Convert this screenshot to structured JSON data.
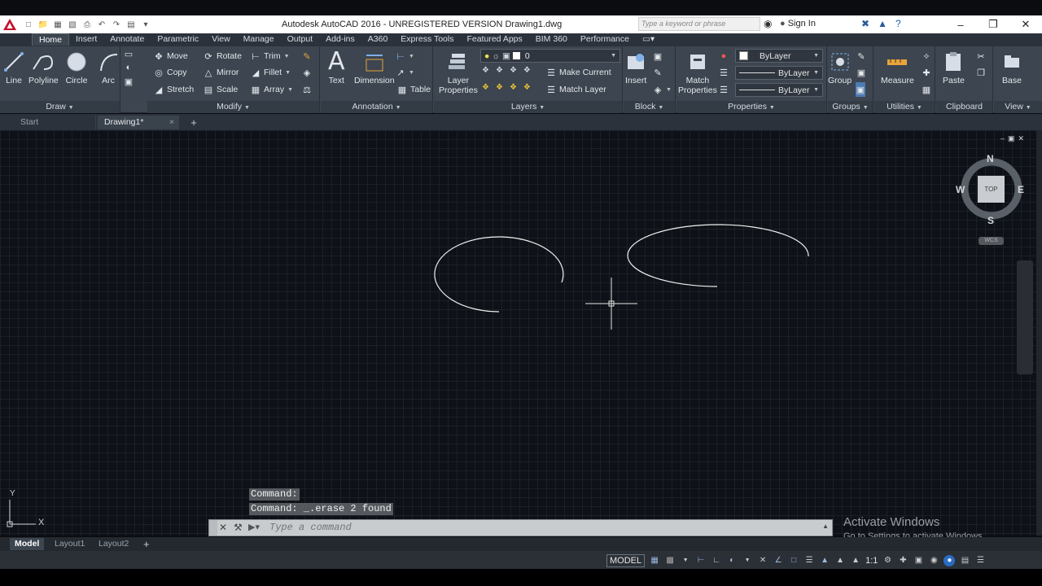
{
  "app": {
    "title": "Autodesk AutoCAD 2016 - UNREGISTERED VERSION    Drawing1.dwg",
    "search_placeholder": "Type a keyword or phrase",
    "sign_in": "Sign In"
  },
  "ribbon_tabs": [
    "Home",
    "Insert",
    "Annotate",
    "Parametric",
    "View",
    "Manage",
    "Output",
    "Add-ins",
    "A360",
    "Express Tools",
    "Featured Apps",
    "BIM 360",
    "Performance"
  ],
  "draw": {
    "title": "Draw",
    "line": "Line",
    "polyline": "Polyline",
    "circle": "Circle",
    "arc": "Arc"
  },
  "modify": {
    "title": "Modify",
    "move": "Move",
    "rotate": "Rotate",
    "trim": "Trim",
    "copy": "Copy",
    "mirror": "Mirror",
    "fillet": "Fillet",
    "stretch": "Stretch",
    "scale": "Scale",
    "array": "Array"
  },
  "annotation": {
    "title": "Annotation",
    "text": "Text",
    "dimension": "Dimension",
    "table": "Table"
  },
  "layers": {
    "title": "Layers",
    "layer_properties": "Layer\nProperties",
    "current_layer": "0",
    "make_current": "Make Current",
    "match_layer": "Match Layer"
  },
  "block": {
    "title": "Block",
    "insert": "Insert"
  },
  "properties": {
    "title": "Properties",
    "match_properties": "Match\nProperties",
    "color": "ByLayer",
    "linetype": "ByLayer",
    "lineweight": "ByLayer"
  },
  "groups": {
    "title": "Groups",
    "group": "Group"
  },
  "utilities": {
    "title": "Utilities",
    "measure": "Measure"
  },
  "clipboard": {
    "title": "Clipboard",
    "paste": "Paste"
  },
  "view_panel": {
    "title": "View",
    "base": "Base"
  },
  "doc_tabs": {
    "start": "Start",
    "drawing": "Drawing1*"
  },
  "viewcube": {
    "n": "N",
    "s": "S",
    "e": "E",
    "w": "W",
    "top": "TOP",
    "wcs": "WCS"
  },
  "ucs": {
    "x": "X",
    "y": "Y"
  },
  "command": {
    "history": [
      "Command:",
      "Command: _.erase 2 found"
    ],
    "placeholder": "Type a command"
  },
  "watermark": {
    "line1": "Activate Windows",
    "line2": "Go to Settings to activate Windows."
  },
  "layout_tabs": [
    "Model",
    "Layout1",
    "Layout2"
  ],
  "status": {
    "model": "MODEL",
    "scale": "1:1"
  }
}
